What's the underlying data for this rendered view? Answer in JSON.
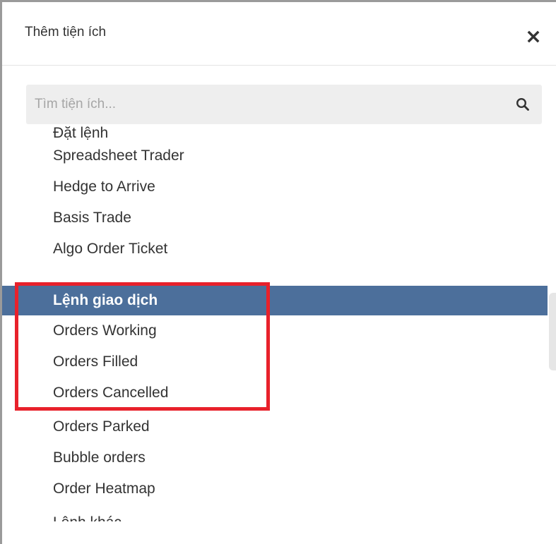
{
  "dialog": {
    "title": "Thêm tiện ích",
    "close_icon": "close-icon"
  },
  "search": {
    "placeholder": "Tìm tiện ích...",
    "value": "",
    "icon": "search-icon"
  },
  "list": {
    "items": [
      {
        "label": "Đặt lệnh"
      },
      {
        "label": "Spreadsheet Trader"
      },
      {
        "label": "Hedge to Arrive"
      },
      {
        "label": "Basis Trade"
      },
      {
        "label": "Algo Order Ticket"
      },
      {
        "label": "Lệnh giao dịch",
        "selected": true
      },
      {
        "label": "Orders Working"
      },
      {
        "label": "Orders Filled"
      },
      {
        "label": "Orders Cancelled"
      },
      {
        "label": "Orders Parked"
      },
      {
        "label": "Bubble orders"
      },
      {
        "label": "Order Heatmap"
      },
      {
        "label": "Lệnh khác"
      }
    ]
  },
  "colors": {
    "selected_bg": "#4c6f9b",
    "highlight_border": "#e8212b"
  }
}
